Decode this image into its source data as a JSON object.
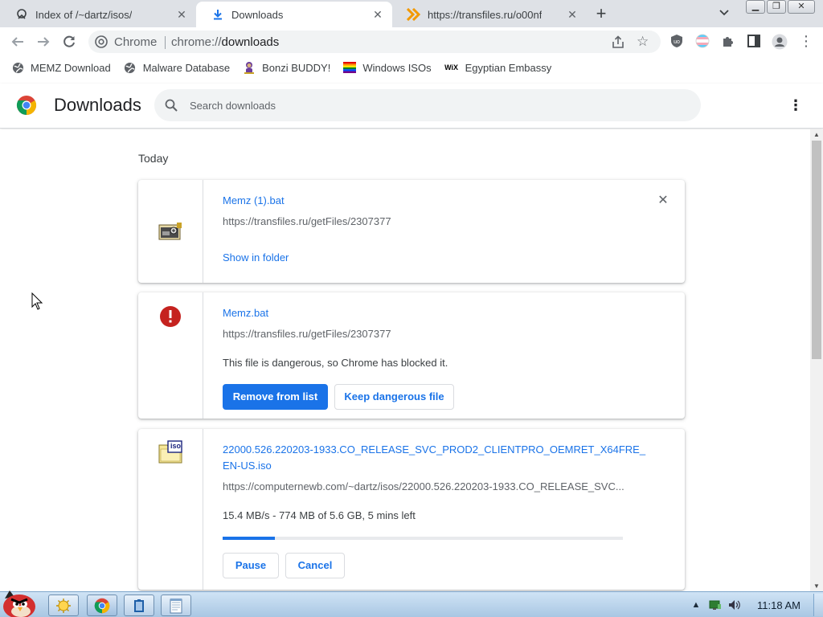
{
  "tabs": [
    {
      "label": "Index of /~dartz/isos/",
      "icon": "web-icon",
      "active": false
    },
    {
      "label": "Downloads",
      "icon": "download-icon",
      "active": true
    },
    {
      "label": "https://transfiles.ru/o00nf",
      "icon": "chevron-orange-icon",
      "active": false
    }
  ],
  "omnibox": {
    "chip": "Chrome",
    "url_scheme": "chrome://",
    "url_path": "downloads"
  },
  "bookmarks": [
    {
      "label": "MEMZ Download",
      "icon": "globe-icon"
    },
    {
      "label": "Malware Database",
      "icon": "globe-icon"
    },
    {
      "label": "Bonzi BUDDY!",
      "icon": "bonzi-icon"
    },
    {
      "label": "Windows ISOs",
      "icon": "rainbow-flag-icon"
    },
    {
      "label": "Egyptian Embassy",
      "icon": "wix-icon"
    }
  ],
  "bookmark_wix_text": "WiX",
  "page": {
    "title": "Downloads",
    "search_placeholder": "Search downloads",
    "section_date": "Today"
  },
  "downloads": [
    {
      "file_name": "Memz (1).bat",
      "url": "https://transfiles.ru/getFiles/2307377",
      "action_link": "Show in folder",
      "icon": "batch-file-icon"
    },
    {
      "file_name": "Memz.bat",
      "url": "https://transfiles.ru/getFiles/2307377",
      "status": "This file is dangerous, so Chrome has blocked it.",
      "primary_button": "Remove from list",
      "secondary_button": "Keep dangerous file",
      "icon": "danger-icon"
    },
    {
      "file_name_line1": "22000.526.220203-1933.CO_RELEASE_SVC_PROD2_CLIENTPRO_OEMRET_X64FRE_",
      "file_name_line2": "EN-US.iso",
      "url": "https://computernewb.com/~dartz/isos/22000.526.220203-1933.CO_RELEASE_SVC...",
      "status": "15.4 MB/s - 774 MB of 5.6 GB, 5 mins left",
      "progress_fraction": 0.13,
      "pause_button": "Pause",
      "cancel_button": "Cancel",
      "icon": "iso-file-icon",
      "iso_badge": "iso"
    }
  ],
  "taskbar": {
    "clock": "11:18 AM"
  },
  "colors": {
    "accent": "#1a73e8",
    "danger": "#c5221f",
    "tabstrip": "#dee1e6"
  }
}
